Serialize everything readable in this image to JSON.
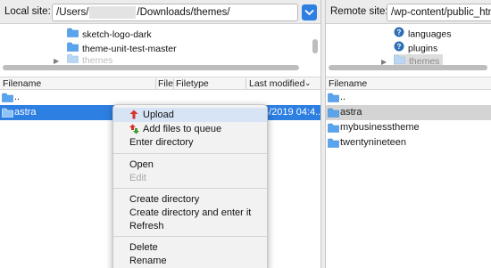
{
  "local": {
    "label": "Local site:",
    "path_prefix": "/Users/",
    "path_redacted": "",
    "path_suffix": "/Downloads/themes/",
    "tree": [
      {
        "label": "sketch-logo-dark"
      },
      {
        "label": "theme-unit-test-master"
      },
      {
        "label": "themes"
      }
    ],
    "columns": {
      "filename": "Filename",
      "filesize": "File",
      "filetype": "Filetype",
      "last_modified": "Last modified"
    },
    "rows": [
      {
        "name": "..",
        "date": ""
      },
      {
        "name": "astra",
        "date": "4/2019 04:4..."
      }
    ]
  },
  "remote": {
    "label": "Remote site:",
    "path": "/wp-content/public_htm",
    "tree": [
      {
        "label": "languages"
      },
      {
        "label": "plugins"
      },
      {
        "label": "themes"
      }
    ],
    "columns": {
      "filename": "Filename"
    },
    "rows": [
      {
        "name": ".."
      },
      {
        "name": "astra"
      },
      {
        "name": "mybusinesstheme"
      },
      {
        "name": "twentynineteen"
      }
    ]
  },
  "context_menu": {
    "items": [
      {
        "label": "Upload",
        "state": "highlighted"
      },
      {
        "label": "Add files to queue",
        "state": "normal"
      },
      {
        "label": "Enter directory",
        "state": "normal"
      },
      {
        "label": "Open",
        "state": "normal"
      },
      {
        "label": "Edit",
        "state": "disabled"
      },
      {
        "label": "Create directory",
        "state": "normal"
      },
      {
        "label": "Create directory and enter it",
        "state": "normal"
      },
      {
        "label": "Refresh",
        "state": "normal"
      },
      {
        "label": "Delete",
        "state": "normal"
      },
      {
        "label": "Rename",
        "state": "normal"
      }
    ]
  },
  "colors": {
    "selection": "#2d7fe2",
    "menu_highlight": "#d7e4f6",
    "upload_arrow": "#d9302c",
    "queue_arrow_up": "#d9302c",
    "queue_arrow_down": "#3a9b2f"
  }
}
